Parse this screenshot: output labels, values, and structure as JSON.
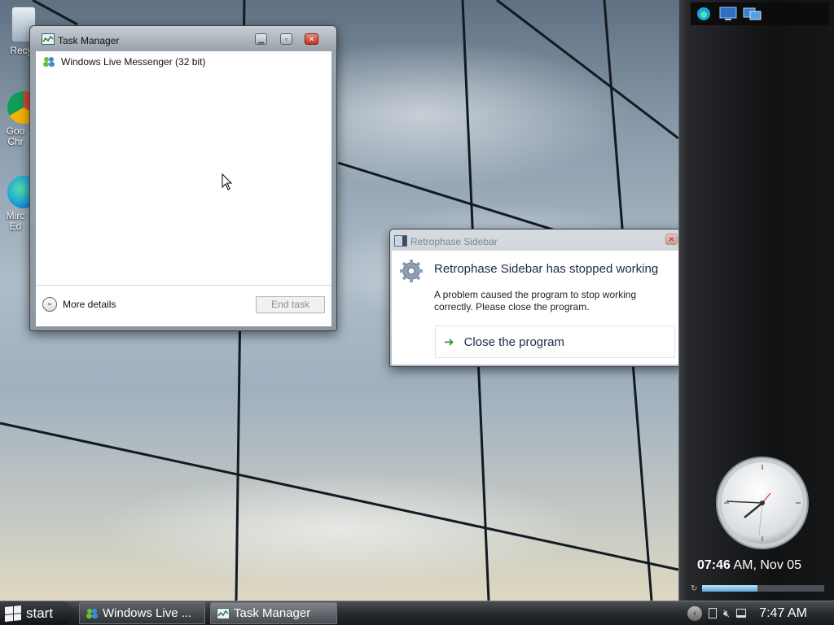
{
  "desktop": {
    "icons": [
      {
        "label": "Recyc",
        "icon": "recycle-bin-icon"
      },
      {
        "label": "Goo Chr",
        "icon": "chrome-icon"
      },
      {
        "label": "Mirc Ed",
        "icon": "edge-icon"
      }
    ]
  },
  "task_manager": {
    "title": "Task Manager",
    "processes": [
      {
        "name": "Windows Live Messenger (32 bit)",
        "icon": "messenger-icon"
      }
    ],
    "more_details_label": "More details",
    "end_task_label": "End task"
  },
  "error_dialog": {
    "title": "Retrophase Sidebar",
    "heading": "Retrophase Sidebar has stopped working",
    "body": "A problem caused the program to stop working correctly. Please close the program.",
    "action_label": "Close the program"
  },
  "sidebar": {
    "top_icons": [
      "edge-icon",
      "monitor-icon",
      "screens-icon"
    ],
    "clock": {
      "time": "07:46",
      "rest": "AM, Nov 05"
    },
    "progress": 0.45
  },
  "taskbar": {
    "start_label": "start",
    "buttons": [
      {
        "label": "Windows Live ...",
        "icon": "messenger-icon"
      },
      {
        "label": "Task Manager",
        "icon": "task-manager-icon"
      }
    ],
    "tray": {
      "time": "7:47 AM",
      "icons": [
        "chevron-left-icon",
        "window-icon",
        "volume-muted-icon",
        "network-icon"
      ]
    }
  },
  "colors": {
    "accent": "#1b2a4a",
    "close_red": "#c0341c",
    "green_arrow": "#2e9c2e"
  }
}
